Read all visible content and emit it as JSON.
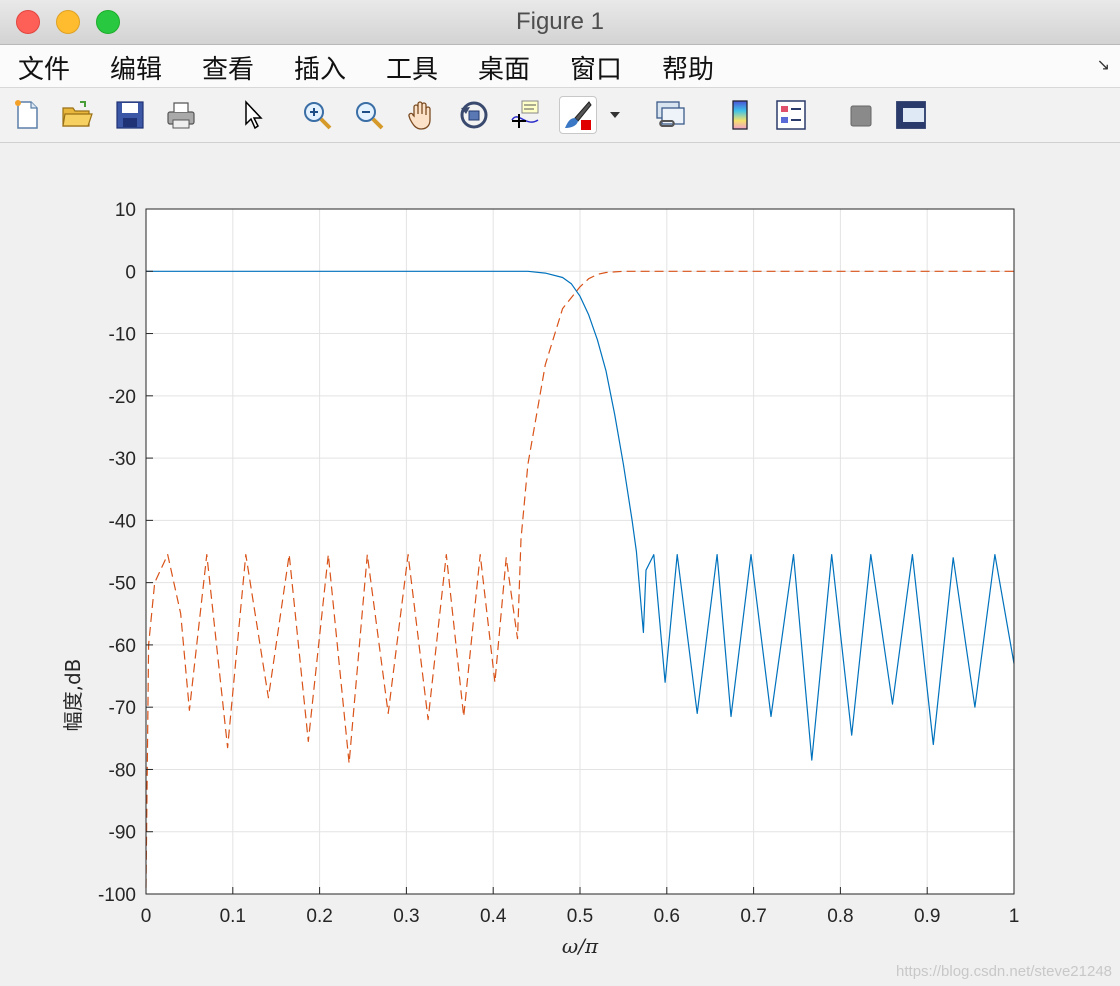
{
  "window": {
    "title": "Figure 1"
  },
  "menu": {
    "items": [
      "文件",
      "编辑",
      "查看",
      "插入",
      "工具",
      "桌面",
      "窗口",
      "帮助"
    ]
  },
  "toolbar": {
    "icons": [
      "new-file-icon",
      "open-folder-icon",
      "save-icon",
      "print-icon",
      "pointer-icon",
      "zoom-in-icon",
      "zoom-out-icon",
      "pan-hand-icon",
      "rotate-3d-icon",
      "data-cursor-icon",
      "brush-icon",
      "link-plot-icon",
      "colorbar-icon",
      "legend-icon",
      "hide-plot-tools-icon",
      "show-plot-tools-icon"
    ]
  },
  "watermark": "https://blog.csdn.net/steve21248",
  "colors": {
    "series1": "#0072bd",
    "series2": "#d95319"
  },
  "chart_data": {
    "type": "line",
    "title": "",
    "xlabel": "ω/π",
    "ylabel": "幅度,dB",
    "xlim": [
      0,
      1
    ],
    "ylim": [
      -100,
      10
    ],
    "xticks": [
      "0",
      "0.1",
      "0.2",
      "0.3",
      "0.4",
      "0.5",
      "0.6",
      "0.7",
      "0.8",
      "0.9",
      "1"
    ],
    "yticks": [
      "10",
      "0",
      "-10",
      "-20",
      "-30",
      "-40",
      "-50",
      "-60",
      "-70",
      "-80",
      "-90",
      "-100"
    ],
    "grid": true,
    "series": [
      {
        "style": "solid",
        "color": "#0072bd",
        "x": [
          0,
          0.44,
          0.46,
          0.48,
          0.49,
          0.5,
          0.51,
          0.52,
          0.53,
          0.54,
          0.55,
          0.56,
          0.565,
          0.573,
          0.576,
          0.585,
          0.598,
          0.612,
          0.635,
          0.658,
          0.674,
          0.697,
          0.72,
          0.746,
          0.767,
          0.79,
          0.813,
          0.835,
          0.86,
          0.883,
          0.907,
          0.93,
          0.955,
          0.978,
          1.0
        ],
        "y": [
          0,
          0,
          -0.3,
          -1,
          -2,
          -4,
          -7,
          -11,
          -16,
          -23,
          -31,
          -40,
          -45,
          -58,
          -48,
          -45.5,
          -66,
          -45.5,
          -71,
          -45.5,
          -71.5,
          -45.5,
          -71.5,
          -45.5,
          -78.5,
          -45.5,
          -74.5,
          -45.5,
          -69.5,
          -45.5,
          -76,
          -46,
          -70,
          -45.5,
          -63
        ]
      },
      {
        "style": "dashed",
        "color": "#d95319",
        "x": [
          0,
          0.003,
          0.01,
          0.025,
          0.04,
          0.05,
          0.07,
          0.094,
          0.115,
          0.141,
          0.165,
          0.187,
          0.21,
          0.234,
          0.255,
          0.279,
          0.302,
          0.325,
          0.346,
          0.366,
          0.385,
          0.402,
          0.415,
          0.428,
          0.432,
          0.44,
          0.46,
          0.48,
          0.5,
          0.51,
          0.52,
          0.53,
          0.54,
          0.55,
          0.58,
          1.0
        ],
        "y": [
          -99,
          -60,
          -50,
          -45.5,
          -55,
          -70.5,
          -45.5,
          -76.5,
          -45.5,
          -68.5,
          -45.5,
          -75.5,
          -45.5,
          -79,
          -45.5,
          -71,
          -45.5,
          -72,
          -45.5,
          -71.5,
          -45.5,
          -66,
          -46,
          -59,
          -43,
          -31,
          -15,
          -6,
          -2.5,
          -1.2,
          -0.5,
          -0.2,
          -0.1,
          0,
          0,
          0
        ]
      }
    ]
  }
}
